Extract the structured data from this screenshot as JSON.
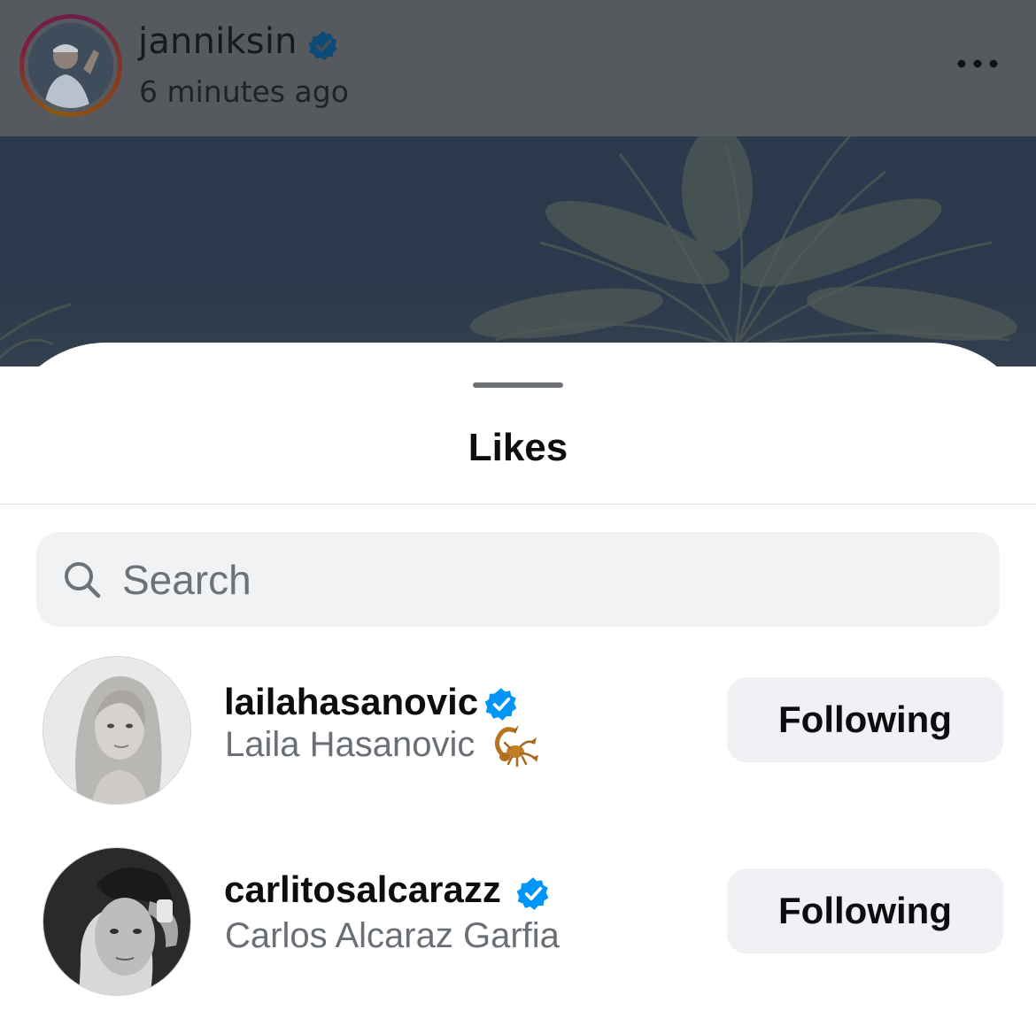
{
  "post": {
    "username": "janniksin",
    "timestamp": "6 minutes ago",
    "verified_icon": "verified-badge-icon",
    "more_icon": "more-horizontal-icon"
  },
  "sheet": {
    "title": "Likes",
    "search": {
      "placeholder": "Search",
      "value": ""
    }
  },
  "users": [
    {
      "handle": "lailahasanovic",
      "full_name": "Laila Hasanovic",
      "name_emoji": "scorpion-icon",
      "verified": true,
      "button_label": "Following"
    },
    {
      "handle": "carlitosalcarazz",
      "full_name": "Carlos Alcaraz Garfia",
      "verified": true,
      "button_label": "Following"
    }
  ],
  "colors": {
    "verified_blue": "#0095f6",
    "dim_overlay": "#56595d",
    "button_bg": "#eff1f4",
    "secondary_text": "#6a6f76"
  }
}
